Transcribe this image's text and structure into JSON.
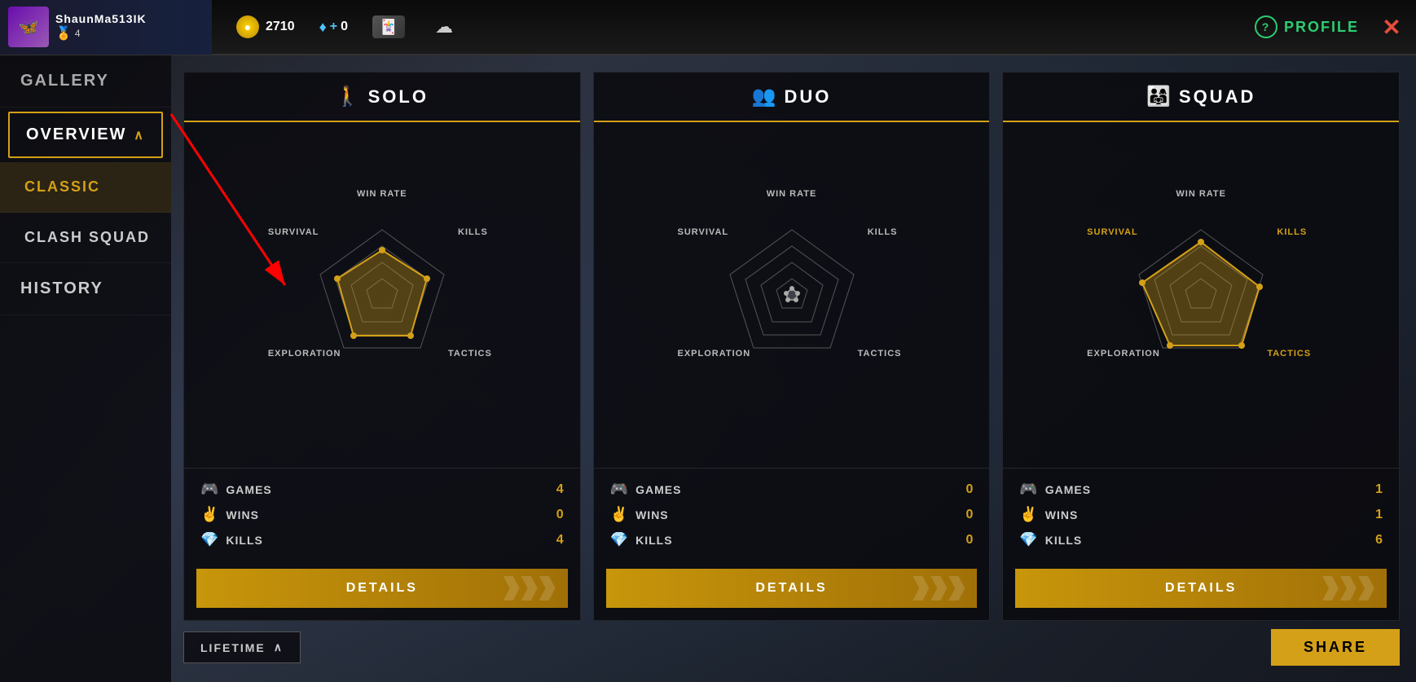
{
  "topbar": {
    "username": "ShaunMa513IK",
    "level": "4",
    "coins": "2710",
    "diamonds": "0",
    "profile_label": "PROFILE",
    "close_label": "✕"
  },
  "sidebar": {
    "gallery_label": "GALLERY",
    "overview_label": "OVERVIEW",
    "classic_label": "CLASSIC",
    "clash_squad_label": "CLASH SQUAD",
    "history_label": "HISTORY"
  },
  "solo": {
    "title": "SOLO",
    "labels": {
      "win_rate": "WIN RATE",
      "kills": "KILLS",
      "tactics": "TACTICS",
      "exploration": "EXPLORATION",
      "survival": "SURVIVAL"
    },
    "stats": {
      "games_label": "GAMES",
      "games_value": "4",
      "wins_label": "WINS",
      "wins_value": "0",
      "kills_label": "KILLS",
      "kills_value": "4"
    },
    "details_label": "DETAILS"
  },
  "duo": {
    "title": "DUO",
    "labels": {
      "win_rate": "WIN RATE",
      "kills": "KILLS",
      "tactics": "TACTICS",
      "exploration": "EXPLORATION",
      "survival": "SURVIVAL"
    },
    "stats": {
      "games_label": "GAMES",
      "games_value": "0",
      "wins_label": "WINS",
      "wins_value": "0",
      "kills_label": "KILLS",
      "kills_value": "0"
    },
    "details_label": "DETAILS"
  },
  "squad": {
    "title": "SQUAD",
    "labels": {
      "win_rate": "WIN RATE",
      "kills": "KILLS",
      "tactics": "TACTICS",
      "exploration": "EXPLORATION",
      "survival": "SURVIVAL"
    },
    "stats": {
      "games_label": "GAMES",
      "games_value": "1",
      "wins_label": "WINS",
      "wins_value": "1",
      "kills_label": "KILLS",
      "kills_value": "6"
    },
    "details_label": "DETAILS"
  },
  "bottom": {
    "lifetime_label": "LIFETIME",
    "share_label": "SHARE"
  },
  "colors": {
    "gold": "#d4a017",
    "accent": "#c8960a"
  }
}
